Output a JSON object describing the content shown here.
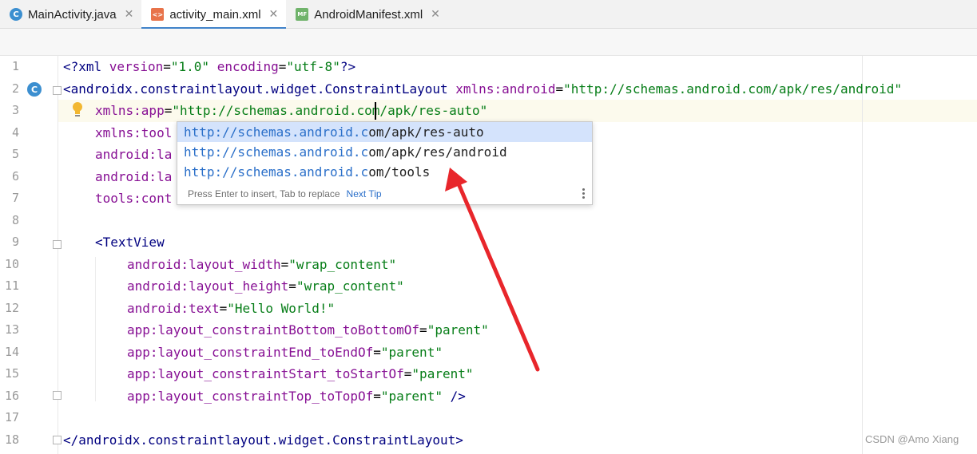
{
  "tabs": [
    {
      "label": "MainActivity.java",
      "icon": "java-class-icon",
      "active": false
    },
    {
      "label": "activity_main.xml",
      "icon": "xml-file-icon",
      "active": true
    },
    {
      "label": "AndroidManifest.xml",
      "icon": "manifest-file-icon",
      "active": false
    }
  ],
  "tab_close": "✕",
  "line_numbers": [
    "1",
    "2",
    "3",
    "4",
    "5",
    "6",
    "7",
    "8",
    "9",
    "10",
    "11",
    "12",
    "13",
    "14",
    "15",
    "16",
    "17",
    "18"
  ],
  "code": {
    "l1": {
      "a": "<?xml ",
      "b": "version",
      "c": "=",
      "d": "\"1.0\"",
      "e": " ",
      "f": "encoding",
      "g": "=",
      "h": "\"utf-8\"",
      "i": "?>"
    },
    "l2": {
      "a": "<androidx.constraintlayout.widget.ConstraintLayout ",
      "b": "xmlns:android",
      "c": "=",
      "d": "\"http://schemas.android.com/apk/res/android\""
    },
    "l3": {
      "a": "xmlns:app",
      "b": "=",
      "c": "\"http://schemas.android.com/apk/res-auto\""
    },
    "l4": {
      "a": "xmlns:tool"
    },
    "l5": {
      "a": "android:la"
    },
    "l6": {
      "a": "android:la"
    },
    "l7": {
      "a": "tools:cont"
    },
    "l9": {
      "a": "<TextView"
    },
    "l10": {
      "a": "android:layout_width",
      "b": "=",
      "c": "\"wrap_content\""
    },
    "l11": {
      "a": "android:layout_height",
      "b": "=",
      "c": "\"wrap_content\""
    },
    "l12": {
      "a": "android:text",
      "b": "=",
      "c": "\"Hello World!\""
    },
    "l13": {
      "a": "app:layout_constraintBottom_toBottomOf",
      "b": "=",
      "c": "\"parent\""
    },
    "l14": {
      "a": "app:layout_constraintEnd_toEndOf",
      "b": "=",
      "c": "\"parent\""
    },
    "l15": {
      "a": "app:layout_constraintStart_toStartOf",
      "b": "=",
      "c": "\"parent\""
    },
    "l16": {
      "a": "app:layout_constraintTop_toTopOf",
      "b": "=",
      "c": "\"parent\"",
      "d": " />"
    },
    "l18": {
      "a": "</androidx.constraintlayout.widget.ConstraintLayout>"
    }
  },
  "gutter_icon_letter": "C",
  "completion": {
    "items": [
      {
        "match": "http://schemas.android.c",
        "rest": "om/apk/res-auto",
        "selected": true
      },
      {
        "match": "http://schemas.android.c",
        "rest": "om/apk/res/android",
        "selected": false
      },
      {
        "match": "http://schemas.android.c",
        "rest": "om/tools",
        "selected": false
      }
    ],
    "hint": "Press Enter to insert, Tab to replace",
    "next_tip": "Next Tip"
  },
  "watermark": "CSDN @Amo Xiang",
  "colors": {
    "tag": "#000080",
    "attribute": "#871094",
    "value": "#067d17",
    "accent": "#4083c9",
    "arrow": "#e8262b"
  }
}
